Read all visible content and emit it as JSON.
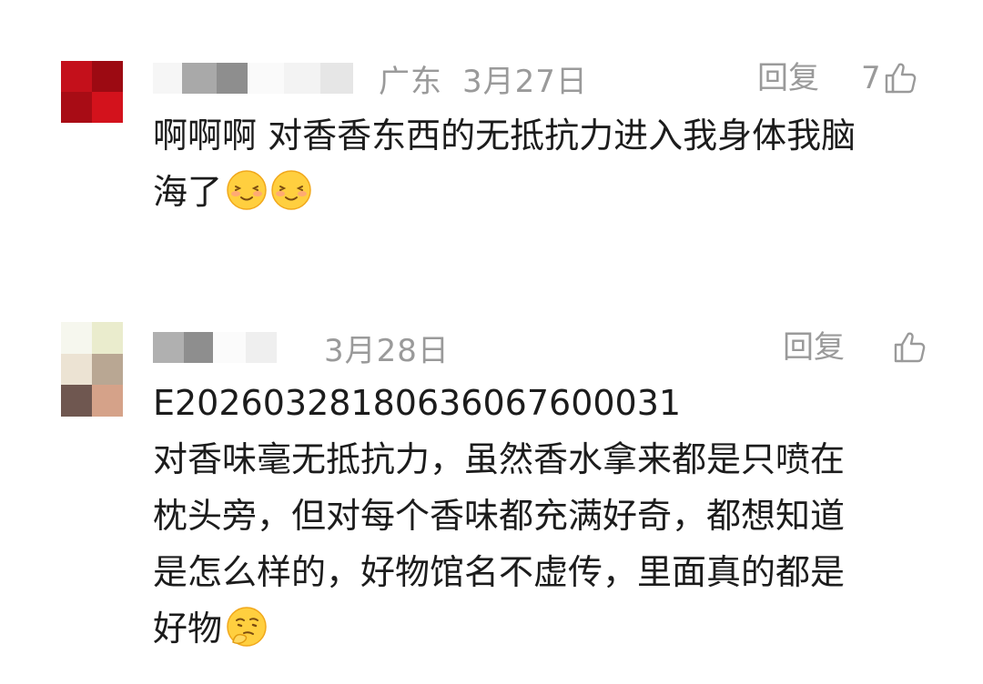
{
  "comments": [
    {
      "location": "广东",
      "date": "3月27日",
      "reply_label": "回复",
      "likes": "7",
      "lines": [
        "啊啊啊 对香香东西的无抵抗力进入我身体我脑",
        "海了"
      ],
      "emojis": [
        "shy-smile-emoji",
        "shy-smile-emoji"
      ],
      "avatar_colors": [
        "#c4101b",
        "#9c0a12",
        "#a80c15",
        "#d3121c"
      ]
    },
    {
      "location": "",
      "date": "3月28日",
      "reply_label": "回复",
      "likes": "",
      "lines": [
        "E2026032818063606760​0031",
        "对香味毫无抵抗力，虽然香水拿来都是只喷在",
        "枕头旁，但对每个香味都充满好奇，都想知道",
        "是怎么样的，好物馆名不虚传，里面真的都是",
        "好物"
      ],
      "emojis": [
        "thinking-emoji"
      ],
      "avatar_colors": [
        "#f6f7ee",
        "#eaeccd",
        "#ece3d3",
        "#b9a793",
        "#6f5750",
        "#d5a289"
      ]
    }
  ]
}
